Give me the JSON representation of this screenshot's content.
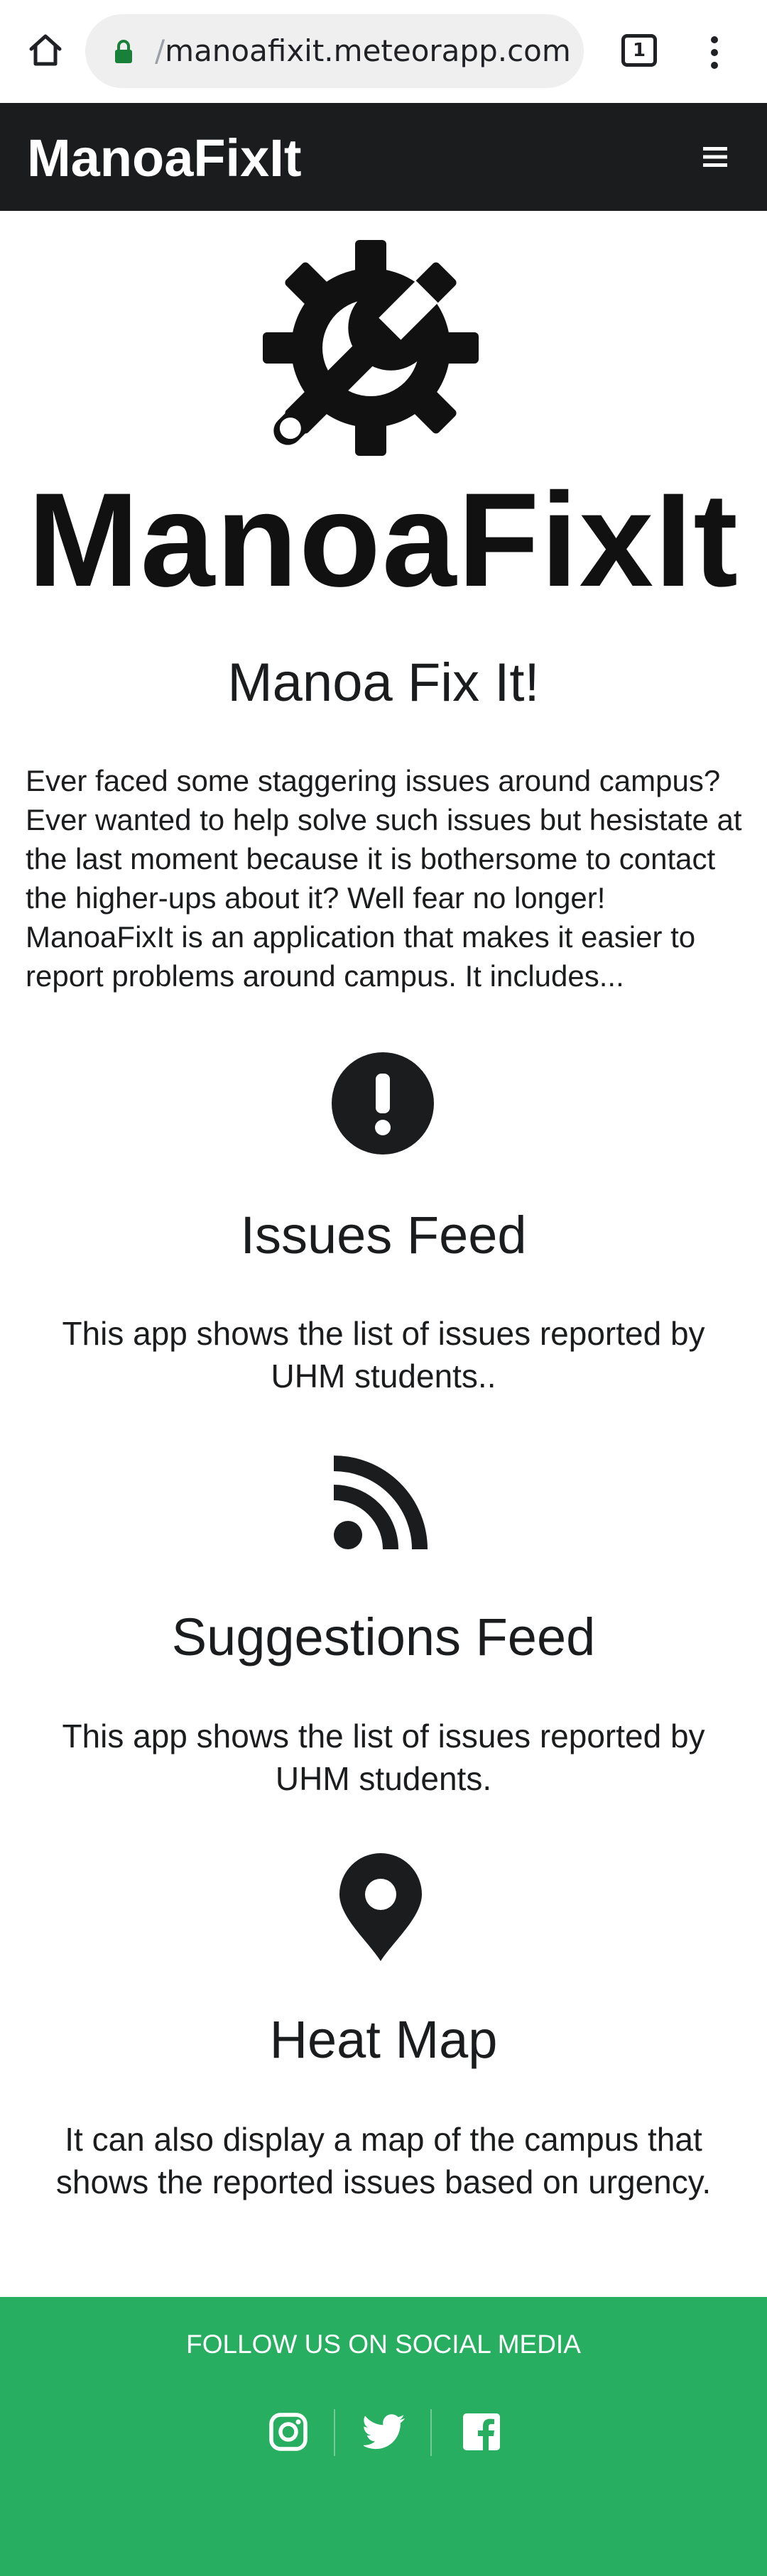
{
  "browser": {
    "url_prefix": "/",
    "url": "manoafixit.meteorapp.com",
    "tab_count": "1"
  },
  "navbar": {
    "brand": "ManoaFixIt"
  },
  "logo": {
    "wordmark": "ManoaFixIt"
  },
  "main": {
    "title": "Manoa Fix It!",
    "intro": "Ever faced some staggering issues around campus? Ever wanted to help solve such issues but hesistate at the last moment because it is bothersome to contact the higher-ups about it? Well fear no longer! ManoaFixIt is an application that makes it easier to report problems around campus. It includes..."
  },
  "features": [
    {
      "icon": "exclamation-circle-icon",
      "title": "Issues Feed",
      "description": "This app shows the list of issues reported by UHM students.."
    },
    {
      "icon": "rss-feed-icon",
      "title": "Suggestions Feed",
      "description": "This app shows the list of issues reported by UHM students."
    },
    {
      "icon": "map-pin-icon",
      "title": "Heat Map",
      "description": "It can also display a map of the campus that shows the reported issues based on urgency."
    }
  ],
  "footer": {
    "follow_text": "FOLLOW US ON SOCIAL MEDIA",
    "social": [
      "instagram-icon",
      "twitter-icon",
      "facebook-icon"
    ]
  },
  "colors": {
    "navbar_bg": "#1b1c1d",
    "footer_bg": "#27ae60",
    "text": "#1b1c1d",
    "lock_green": "#188038"
  }
}
